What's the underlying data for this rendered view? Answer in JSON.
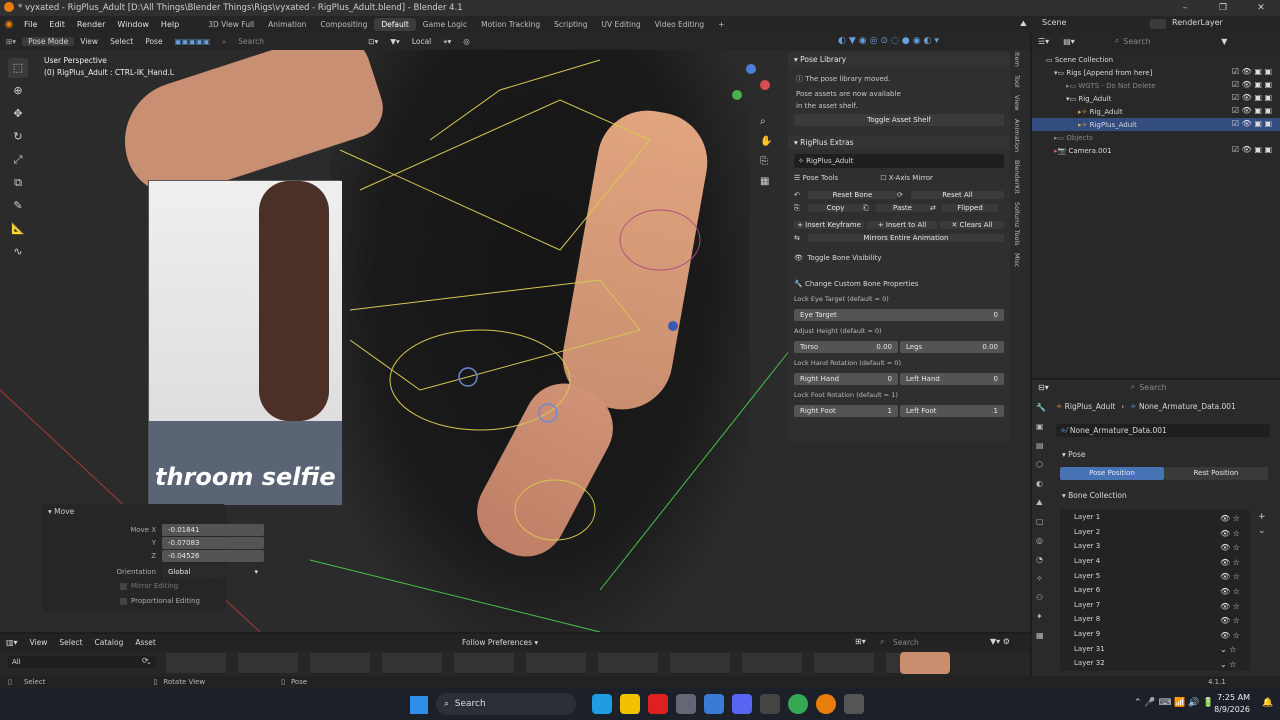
{
  "window": {
    "title": "* vyxated - RigPlus_Adult [D:\\All Things\\Blender Things\\Rigs\\vyxated - RigPlus_Adult.blend] - Blender 4.1",
    "controls": [
      "–",
      "❐",
      "✕"
    ]
  },
  "menubar": {
    "menus": [
      "File",
      "Edit",
      "Render",
      "Window",
      "Help"
    ],
    "workspaces": [
      "3D View Full",
      "Animation",
      "Compositing",
      "Default",
      "Game Logic",
      "Motion Tracking",
      "Scripting",
      "UV Editing",
      "Video Editing"
    ],
    "active_workspace": "Default",
    "add": "+",
    "scene_label": "Scene",
    "view_layer_label": "RenderLayer"
  },
  "viewport_header": {
    "mode": "Pose Mode",
    "menus": [
      "View",
      "Select",
      "Pose"
    ],
    "search_placeholder": "Search",
    "transform_orientation": "Local"
  },
  "viewport": {
    "perspective": "User Perspective",
    "context": "(0) RigPlus_Adult : CTRL-IK_Hand.L",
    "overlay_text": "throom selfie"
  },
  "operator_panel": {
    "title": "Move",
    "move_x_label": "Move X",
    "move_x": "-0.01841",
    "y_label": "Y",
    "y": "-0.07083",
    "z_label": "Z",
    "z": "-0.04526",
    "orientation_label": "Orientation",
    "orientation": "Global",
    "mirror": "Mirror Editing",
    "proportional": "Proportional Editing"
  },
  "npanel": {
    "pose_library": {
      "title": "Pose Library",
      "line1": "The pose library moved.",
      "line2": "Pose assets are now available",
      "line3": "in the asset shelf.",
      "toggle": "Toggle Asset Shelf"
    },
    "rigplus": {
      "title": "RigPlus Extras",
      "rig_name": "RigPlus_Adult",
      "pose_tools": "Pose Tools",
      "x_mirror": "X-Axis Mirror",
      "reset_bone": "Reset Bone",
      "reset_all": "Reset All",
      "copy": "Copy",
      "paste": "Paste",
      "flipped": "Flipped",
      "insert_keyframe": "Insert Keyframe",
      "insert_to_all": "Insert to All",
      "clears_all": "Clears All",
      "mirrors_anim": "Mirrors Entire Animation",
      "toggle_bone_vis": "Toggle Bone Visibility",
      "change_custom": "Change Custom Bone Properties",
      "lock_eye": "Lock Eye Target (default = 0)",
      "eye_target": "Eye Target",
      "eye_target_val": "0",
      "adjust_height": "Adjust Height (default = 0)",
      "torso": "Torso",
      "torso_val": "0.00",
      "legs": "Legs",
      "legs_val": "0.00",
      "lock_hand": "Lock Hand Rotation (default = 0)",
      "right_hand": "Right Hand",
      "right_hand_val": "0",
      "left_hand": "Left Hand",
      "left_hand_val": "0",
      "lock_foot": "Lock Foot Rotation (default = 1)",
      "right_foot": "Right Foot",
      "right_foot_val": "1",
      "left_foot": "Left Foot",
      "left_foot_val": "1"
    },
    "side_tabs": [
      "Item",
      "Tool",
      "View",
      "Animation",
      "BlenderKit",
      "Sollumz Tools",
      "Misc"
    ]
  },
  "outliner": {
    "search_placeholder": "Search",
    "items": [
      {
        "label": "Scene Collection",
        "depth": 0
      },
      {
        "label": "Rigs [Append from here]",
        "depth": 1
      },
      {
        "label": "WGTS - Do Not Delete",
        "depth": 2
      },
      {
        "label": "Rig_Adult",
        "depth": 2
      },
      {
        "label": "Rig_Adult",
        "depth": 3
      },
      {
        "label": "RigPlus_Adult",
        "depth": 3
      },
      {
        "label": "Objects",
        "depth": 1
      },
      {
        "label": "Camera.001",
        "depth": 1
      }
    ]
  },
  "properties": {
    "search_placeholder": "Search",
    "breadcrumb1": "RigPlus_Adult",
    "breadcrumb2": "None_Armature_Data.001",
    "data_name": "None_Armature_Data.001",
    "pose_section": "Pose",
    "pose_position": "Pose Position",
    "rest_position": "Rest Position",
    "bone_collection": "Bone Collection",
    "layers": [
      "Layer 1",
      "Layer 2",
      "Layer 3",
      "Layer 4",
      "Layer 5",
      "Layer 6",
      "Layer 7",
      "Layer 8",
      "Layer 9",
      "Layer 31",
      "Layer 32"
    ]
  },
  "asset_shelf": {
    "menus": [
      "View",
      "Select",
      "Catalog",
      "Asset"
    ],
    "follow": "Follow Preferences",
    "filter": "All",
    "search_placeholder": "Search"
  },
  "statusbar": {
    "select": "Select",
    "rotate": "Rotate View",
    "pose": "Pose",
    "version": "4.1.1"
  },
  "taskbar": {
    "search": "Search",
    "time": "7:25 AM",
    "date": "8/9/2026"
  }
}
